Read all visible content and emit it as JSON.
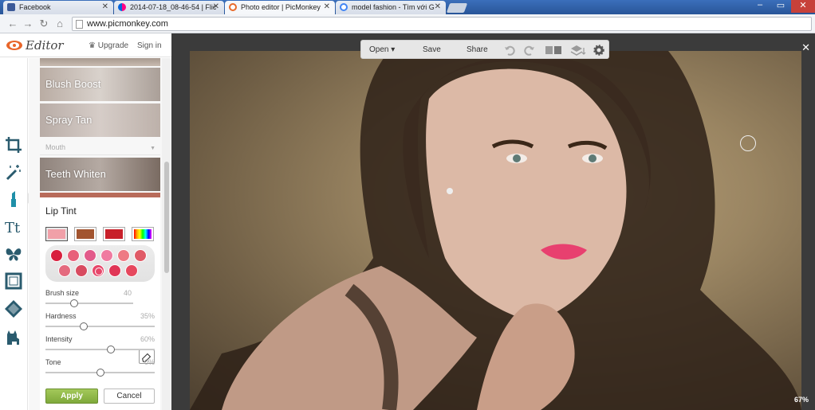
{
  "browser": {
    "tabs": [
      {
        "title": "Facebook",
        "favicon": "facebook-icon"
      },
      {
        "title": "2014-07-18_08-46-54 | Flic",
        "favicon": "flickr-icon"
      },
      {
        "title": "Photo editor | PicMonkey",
        "favicon": "picmonkey-icon"
      },
      {
        "title": "model fashion - Tìm với G",
        "favicon": "google-icon"
      }
    ],
    "url": "www.picmonkey.com"
  },
  "app": {
    "brand": "Editor",
    "upgrade": "Upgrade",
    "sign_in": "Sign in"
  },
  "tools": [
    "crop-icon",
    "magic-wand-icon",
    "lipstick-icon",
    "text-icon",
    "butterfly-icon",
    "frame-icon",
    "texture-icon",
    "cat-icon"
  ],
  "panel": {
    "thumbs": [
      "Blush Boost",
      "Spray Tan",
      "Teeth Whiten"
    ],
    "section": "Mouth",
    "lip_tint": {
      "title": "Lip Tint",
      "presets": [
        "#f0a0a8",
        "#a2542f",
        "#c8202a",
        "rainbow"
      ],
      "swatches_row1": [
        "#d8203e",
        "#e8607a",
        "#e25a8a",
        "#f07aa0",
        "#ee7a84",
        "#e05a66"
      ],
      "swatches_row2": [
        "#e46a7e",
        "#d84b60",
        "#e7476a",
        "#e03656",
        "#e6485e"
      ],
      "sliders": [
        {
          "label": "Brush size",
          "value": "40",
          "level": 0.33
        },
        {
          "label": "Hardness",
          "value": "35%",
          "level": 0.35
        },
        {
          "label": "Intensity",
          "value": "60%",
          "level": 0.6
        },
        {
          "label": "Tone",
          "value": "0%",
          "level": 0.5
        }
      ],
      "apply": "Apply",
      "cancel": "Cancel"
    }
  },
  "toolbar": {
    "open": "Open",
    "save": "Save",
    "share": "Share"
  },
  "zoom": "67%"
}
